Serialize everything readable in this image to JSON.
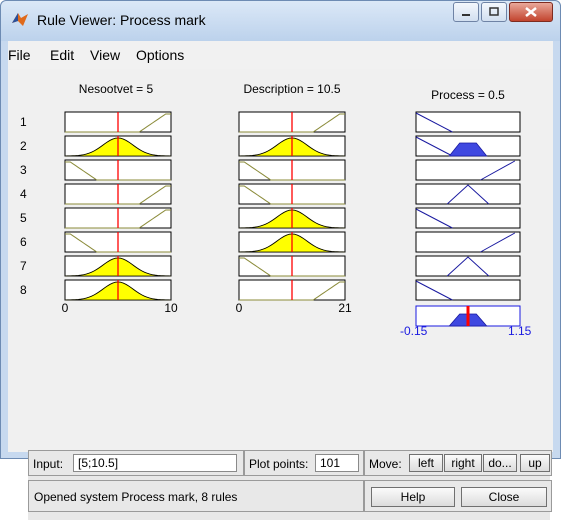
{
  "window": {
    "title": "Rule Viewer: Process mark"
  },
  "menu": [
    "File",
    "Edit",
    "View",
    "Options"
  ],
  "inputs": [
    {
      "label": "Nesootvet = 5",
      "min_label": "0",
      "max_label": "10",
      "range": [
        0,
        10
      ],
      "value": 5
    },
    {
      "label": "Description = 10.5",
      "min_label": "0",
      "max_label": "21",
      "range": [
        0,
        21
      ],
      "value": 10.5
    }
  ],
  "output": {
    "label": "Process = 0.5",
    "min_label": "-0.15",
    "max_label": "1.15",
    "range": [
      -0.15,
      1.15
    ],
    "value": 0.5
  },
  "rules": [
    "1",
    "2",
    "3",
    "4",
    "5",
    "6",
    "7",
    "8"
  ],
  "rule_mfs": [
    {
      "in1": "high",
      "in2": "high",
      "out": "low"
    },
    {
      "in1": "mid",
      "in2": "mid",
      "out": "low"
    },
    {
      "in1": "low",
      "in2": "low",
      "out": "high"
    },
    {
      "in1": "high",
      "in2": "low",
      "out": "mid"
    },
    {
      "in1": "high",
      "in2": "mid",
      "out": "low"
    },
    {
      "in1": "low",
      "in2": "mid",
      "out": "high"
    },
    {
      "in1": "mid",
      "in2": "low",
      "out": "mid"
    },
    {
      "in1": "mid",
      "in2": "high",
      "out": "low"
    }
  ],
  "controls": {
    "input_label": "Input:",
    "input_value": "[5;10.5]",
    "plot_points_label": "Plot points:",
    "plot_points_value": "101",
    "move_label": "Move:",
    "move_buttons": [
      "left",
      "right",
      "do...",
      "up"
    ],
    "status": "Opened system Process mark, 8 rules",
    "help_label": "Help",
    "close_label": "Close"
  },
  "colors": {
    "fill": "#ffff00",
    "output_fill": "#3f48e0",
    "line": "#8b8b3a",
    "output_line": "#1a1aa0",
    "marker": "#ff0000"
  }
}
